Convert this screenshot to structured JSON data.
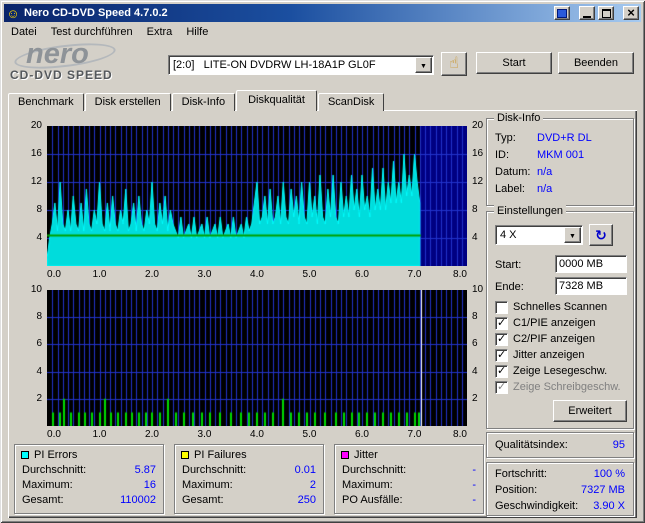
{
  "window": {
    "title": "Nero CD-DVD Speed 4.7.0.2"
  },
  "menu": {
    "items": [
      "Datei",
      "Test durchführen",
      "Extra",
      "Hilfe"
    ]
  },
  "toolbar": {
    "logo_main": "nero",
    "logo_sub": "CD-DVD SPEED",
    "drive_selector": "[2:0]   LITE-ON DVDRW LH-18A1P GL0F",
    "start_label": "Start",
    "quit_label": "Beenden"
  },
  "tabs": {
    "benchmark": "Benchmark",
    "create": "Disk erstellen",
    "info": "Disk-Info",
    "quality": "Diskqualität",
    "scandisk": "ScanDisk"
  },
  "disk_info": {
    "title": "Disk-Info",
    "rows": [
      {
        "label": "Typ:",
        "value": "DVD+R DL"
      },
      {
        "label": "ID:",
        "value": "MKM 001"
      },
      {
        "label": "Datum:",
        "value": "n/a"
      },
      {
        "label": "Label:",
        "value": "n/a"
      }
    ]
  },
  "settings": {
    "title": "Einstellungen",
    "speed_value": "4 X",
    "start_label": "Start:",
    "start_value": "0000 MB",
    "end_label": "Ende:",
    "end_value": "7328 MB",
    "checkboxes": [
      {
        "label": "Schnelles Scannen",
        "checked": false,
        "disabled": false
      },
      {
        "label": "C1/PIE anzeigen",
        "checked": true,
        "disabled": false
      },
      {
        "label": "C2/PIF anzeigen",
        "checked": true,
        "disabled": false
      },
      {
        "label": "Jitter anzeigen",
        "checked": true,
        "disabled": false
      },
      {
        "label": "Zeige Lesegeschw.",
        "checked": true,
        "disabled": false
      },
      {
        "label": "Zeige Schreibgeschw.",
        "checked": true,
        "disabled": true
      }
    ],
    "advanced_label": "Erweitert"
  },
  "quality_index": {
    "label": "Qualitätsindex:",
    "value": "95"
  },
  "progress": {
    "rows": [
      {
        "label": "Fortschritt:",
        "value": "100 %"
      },
      {
        "label": "Position:",
        "value": "7327 MB"
      },
      {
        "label": "Geschwindigkeit:",
        "value": "3.90 X"
      }
    ]
  },
  "stats": {
    "pi_errors": {
      "title": "PI Errors",
      "swatch": "#00FFFF",
      "rows": [
        {
          "label": "Durchschnitt:",
          "value": "5.87"
        },
        {
          "label": "Maximum:",
          "value": "16"
        },
        {
          "label": "Gesamt:",
          "value": "110002"
        }
      ]
    },
    "pi_failures": {
      "title": "PI Failures",
      "swatch": "#FFFF00",
      "rows": [
        {
          "label": "Durchschnitt:",
          "value": "0.01"
        },
        {
          "label": "Maximum:",
          "value": "2"
        },
        {
          "label": "Gesamt:",
          "value": "250"
        }
      ]
    },
    "jitter": {
      "title": "Jitter",
      "swatch": "#FF00FF",
      "rows": [
        {
          "label": "Durchschnitt:",
          "value": "-"
        },
        {
          "label": "Maximum:",
          "value": "-"
        },
        {
          "label": "PO Ausfälle:",
          "value": "-"
        }
      ]
    }
  },
  "chart_data": [
    {
      "type": "area",
      "series_name": "PI Errors",
      "xlabel_unit": "GB",
      "xlim": [
        0,
        8
      ],
      "ylim": [
        0,
        20
      ],
      "x_start": 0,
      "x_step": 0.05,
      "values": [
        1,
        4,
        6,
        9,
        5,
        12,
        6,
        5,
        8,
        5,
        10,
        6,
        5,
        9,
        5,
        11,
        6,
        5,
        8,
        6,
        12,
        6,
        5,
        9,
        5,
        10,
        6,
        5,
        8,
        6,
        11,
        5,
        6,
        9,
        5,
        10,
        6,
        5,
        8,
        6,
        12,
        6,
        5,
        9,
        6,
        10,
        5,
        8,
        6,
        5,
        4,
        7,
        4,
        5,
        6,
        4,
        7,
        4,
        5,
        6,
        4,
        7,
        4,
        5,
        6,
        4,
        7,
        4,
        5,
        6,
        4,
        7,
        4,
        5,
        6,
        4,
        7,
        5,
        6,
        9,
        12,
        6,
        7,
        10,
        6,
        11,
        6,
        7,
        10,
        6,
        12,
        7,
        6,
        11,
        7,
        10,
        6,
        12,
        7,
        6,
        12,
        7,
        10,
        6,
        13,
        7,
        6,
        11,
        7,
        13,
        7,
        6,
        12,
        7,
        10,
        7,
        13,
        8,
        11,
        7,
        13,
        8,
        10,
        7,
        14,
        8,
        11,
        8,
        14,
        8,
        12,
        9,
        15,
        9,
        12,
        9,
        16,
        10,
        13,
        10,
        16,
        12,
        9
      ],
      "yticks": [
        20,
        16,
        12,
        8,
        4
      ],
      "xticks": [
        0,
        1,
        2,
        3,
        4,
        5,
        6,
        7,
        8
      ],
      "xtick_labels": [
        "0.0",
        "1.0",
        "2.0",
        "3.0",
        "4.0",
        "5.0",
        "6.0",
        "7.0",
        "8.0"
      ],
      "grid_x_step": 0.1,
      "end_region": 7.12,
      "speed_line": {
        "y": 4.35,
        "x_to": 7.12
      },
      "colors": {
        "bg": "#000000",
        "grid": "#2233cc",
        "fill": "#00dcdc",
        "line": "#00ffff",
        "end_region": "#000082",
        "speed": "#00a000"
      }
    },
    {
      "type": "spikes",
      "series_name": "PI Failures",
      "xlabel_unit": "GB",
      "xlim": [
        0,
        8
      ],
      "ylim": [
        0,
        10
      ],
      "spikes": [
        [
          0.12,
          1
        ],
        [
          0.25,
          1
        ],
        [
          0.33,
          2
        ],
        [
          0.45,
          1
        ],
        [
          0.6,
          1
        ],
        [
          0.72,
          1
        ],
        [
          0.85,
          1
        ],
        [
          1.0,
          1
        ],
        [
          1.1,
          2
        ],
        [
          1.22,
          1
        ],
        [
          1.35,
          1
        ],
        [
          1.5,
          1
        ],
        [
          1.62,
          1
        ],
        [
          1.75,
          1
        ],
        [
          1.88,
          1
        ],
        [
          2.0,
          1
        ],
        [
          2.15,
          1
        ],
        [
          2.3,
          2
        ],
        [
          2.45,
          1
        ],
        [
          2.6,
          1
        ],
        [
          2.78,
          1
        ],
        [
          2.95,
          1
        ],
        [
          3.1,
          1
        ],
        [
          3.3,
          1
        ],
        [
          3.5,
          1
        ],
        [
          3.7,
          1
        ],
        [
          3.85,
          1
        ],
        [
          4.0,
          1
        ],
        [
          4.15,
          1
        ],
        [
          4.3,
          1
        ],
        [
          4.5,
          2
        ],
        [
          4.65,
          1
        ],
        [
          4.8,
          1
        ],
        [
          4.95,
          1
        ],
        [
          5.1,
          1
        ],
        [
          5.3,
          1
        ],
        [
          5.5,
          1
        ],
        [
          5.65,
          1
        ],
        [
          5.8,
          1
        ],
        [
          5.95,
          1
        ],
        [
          6.1,
          1
        ],
        [
          6.25,
          1
        ],
        [
          6.4,
          1
        ],
        [
          6.55,
          1
        ],
        [
          6.7,
          1
        ],
        [
          6.85,
          1
        ],
        [
          7.0,
          1
        ],
        [
          7.08,
          1
        ]
      ],
      "yticks": [
        10,
        8,
        6,
        4,
        2
      ],
      "xticks": [
        0,
        1,
        2,
        3,
        4,
        5,
        6,
        7,
        8
      ],
      "xtick_labels": [
        "0.0",
        "1.0",
        "2.0",
        "3.0",
        "4.0",
        "5.0",
        "6.0",
        "7.0",
        "8.0"
      ],
      "grid_x_step": 0.1,
      "end_marker": 7.12,
      "colors": {
        "bg": "#000000",
        "grid": "#2233cc",
        "spike": "#00dc00",
        "marker": "#ffffff"
      }
    }
  ]
}
